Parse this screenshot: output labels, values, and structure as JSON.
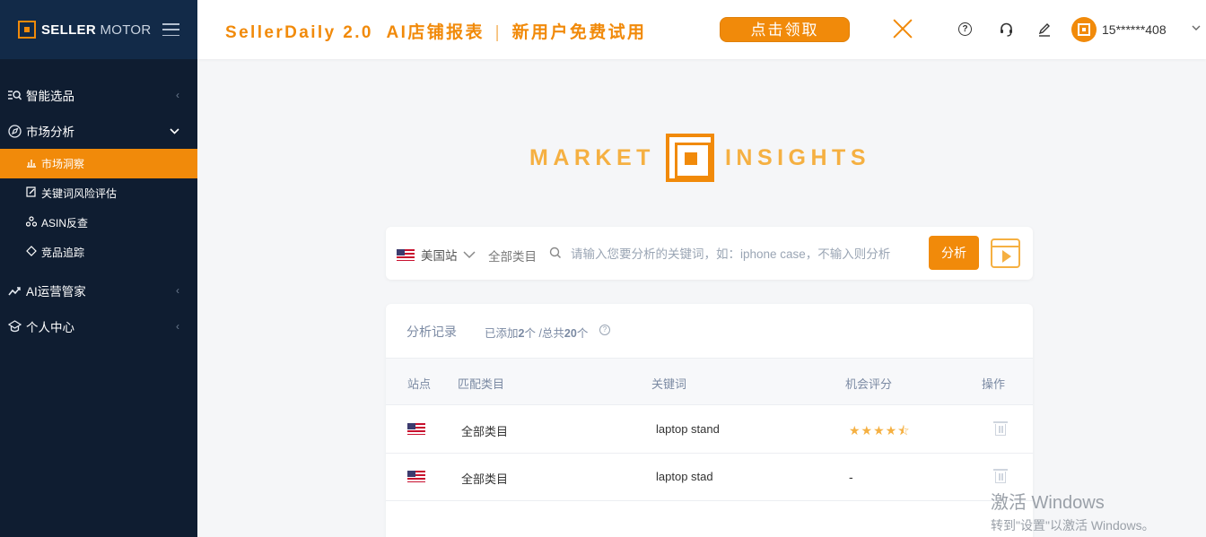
{
  "brand": {
    "seller": "SELLER",
    "motor": "MOTOR"
  },
  "sidebar": {
    "items": [
      {
        "label": "智能选品",
        "icon": "search-list-icon"
      },
      {
        "label": "市场分析",
        "icon": "compass-icon"
      },
      {
        "label": "AI运营管家",
        "icon": "trend-icon"
      },
      {
        "label": "个人中心",
        "icon": "user-center-icon"
      }
    ],
    "subitems": [
      {
        "label": "市场洞察",
        "icon": "bar-chart-icon",
        "active": true
      },
      {
        "label": "关键词风险评估",
        "icon": "edit-doc-icon"
      },
      {
        "label": "ASIN反查",
        "icon": "nodes-icon"
      },
      {
        "label": "竞品追踪",
        "icon": "tag-icon"
      }
    ]
  },
  "topbar": {
    "promo_title": "SellerDaily 2.0  AI店铺报表",
    "promo_sep": "|",
    "promo_sub": "新用户免费试用",
    "promo_button": "点击领取",
    "phone": "15******408"
  },
  "logo": {
    "left": "MARKET",
    "right": "INSIGHTS"
  },
  "search": {
    "site": "美国站",
    "category": "全部类目",
    "placeholder": "请输入您要分析的关键词，如：iphone case，不输入则分析",
    "button": "分析"
  },
  "records": {
    "title": "分析记录",
    "count_prefix": "已添加",
    "added": "2",
    "count_mid": "个 /总共",
    "total": "20",
    "count_suffix": "个",
    "columns": [
      "站点",
      "匹配类目",
      "关键词",
      "机会评分",
      "操作"
    ],
    "rows": [
      {
        "category": "全部类目",
        "keyword": "laptop stand",
        "score": "★★★★⯪",
        "rating": 4.5
      },
      {
        "category": "全部类目",
        "keyword": "laptop stad",
        "score": "-",
        "rating": null
      }
    ]
  },
  "watermark": {
    "line1": "激活 Windows",
    "line2": "转到\"设置\"以激活 Windows。"
  },
  "colors": {
    "accent": "#f18a0a",
    "sidebar": "#0f1d31",
    "brand_bar": "#122a48"
  }
}
